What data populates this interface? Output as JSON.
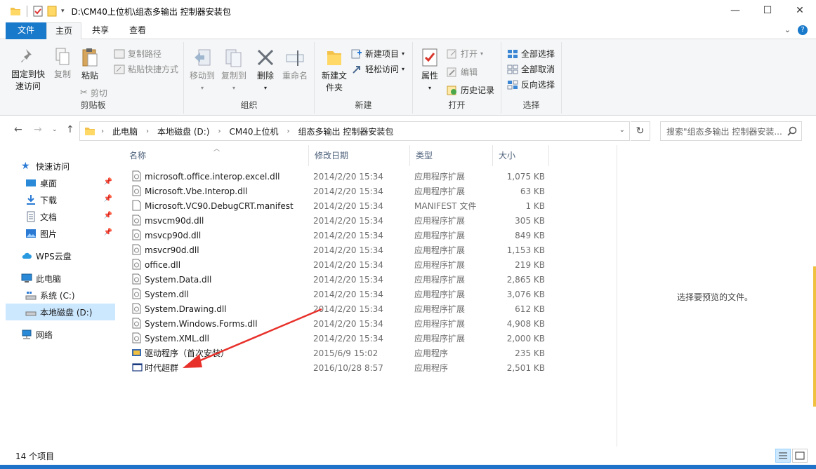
{
  "window": {
    "title": "D:\\CM40上位机\\组态多输出 控制器安装包",
    "controls": {
      "minimize": "—",
      "maximize": "☐",
      "close": "✕"
    }
  },
  "tabs": {
    "file": "文件",
    "home": "主页",
    "share": "共享",
    "view": "查看"
  },
  "ribbon": {
    "clipboard": {
      "label": "剪贴板",
      "pin_quick_access": "固定到快速访问",
      "copy": "复制",
      "paste": "粘贴",
      "copy_path": "复制路径",
      "paste_shortcut": "粘贴快捷方式",
      "cut": "剪切"
    },
    "organize": {
      "label": "组织",
      "move_to": "移动到",
      "copy_to": "复制到",
      "delete": "删除",
      "rename": "重命名"
    },
    "new": {
      "label": "新建",
      "new_folder": "新建文件夹",
      "new_item": "新建项目",
      "easy_access": "轻松访问"
    },
    "open": {
      "label": "打开",
      "properties": "属性",
      "open": "打开",
      "edit": "编辑",
      "history": "历史记录"
    },
    "select": {
      "label": "选择",
      "select_all": "全部选择",
      "select_none": "全部取消",
      "invert": "反向选择"
    }
  },
  "address": {
    "crumbs": [
      "此电脑",
      "本地磁盘 (D:)",
      "CM40上位机",
      "组态多输出 控制器安装包"
    ]
  },
  "search": {
    "placeholder": "搜索\"组态多输出 控制器安装..."
  },
  "nav": {
    "quick_access": "快速访问",
    "desktop": "桌面",
    "downloads": "下载",
    "documents": "文档",
    "pictures": "图片",
    "wps": "WPS云盘",
    "this_pc": "此电脑",
    "system_c": "系统 (C:)",
    "local_d": "本地磁盘 (D:)",
    "network": "网络"
  },
  "columns": {
    "name": "名称",
    "date": "修改日期",
    "type": "类型",
    "size": "大小"
  },
  "files": [
    {
      "name": "microsoft.office.interop.excel.dll",
      "date": "2014/2/20 15:34",
      "type": "应用程序扩展",
      "size": "1,075 KB",
      "icon": "dll-icon"
    },
    {
      "name": "Microsoft.Vbe.Interop.dll",
      "date": "2014/2/20 15:34",
      "type": "应用程序扩展",
      "size": "63 KB",
      "icon": "dll-icon"
    },
    {
      "name": "Microsoft.VC90.DebugCRT.manifest",
      "date": "2014/2/20 15:34",
      "type": "MANIFEST 文件",
      "size": "1 KB",
      "icon": "file-icon"
    },
    {
      "name": "msvcm90d.dll",
      "date": "2014/2/20 15:34",
      "type": "应用程序扩展",
      "size": "305 KB",
      "icon": "dll-icon"
    },
    {
      "name": "msvcp90d.dll",
      "date": "2014/2/20 15:34",
      "type": "应用程序扩展",
      "size": "849 KB",
      "icon": "dll-icon"
    },
    {
      "name": "msvcr90d.dll",
      "date": "2014/2/20 15:34",
      "type": "应用程序扩展",
      "size": "1,153 KB",
      "icon": "dll-icon"
    },
    {
      "name": "office.dll",
      "date": "2014/2/20 15:34",
      "type": "应用程序扩展",
      "size": "219 KB",
      "icon": "dll-icon"
    },
    {
      "name": "System.Data.dll",
      "date": "2014/2/20 15:34",
      "type": "应用程序扩展",
      "size": "2,865 KB",
      "icon": "dll-icon"
    },
    {
      "name": "System.dll",
      "date": "2014/2/20 15:34",
      "type": "应用程序扩展",
      "size": "3,076 KB",
      "icon": "dll-icon"
    },
    {
      "name": "System.Drawing.dll",
      "date": "2014/2/20 15:34",
      "type": "应用程序扩展",
      "size": "612 KB",
      "icon": "dll-icon"
    },
    {
      "name": "System.Windows.Forms.dll",
      "date": "2014/2/20 15:34",
      "type": "应用程序扩展",
      "size": "4,908 KB",
      "icon": "dll-icon"
    },
    {
      "name": "System.XML.dll",
      "date": "2014/2/20 15:34",
      "type": "应用程序扩展",
      "size": "2,000 KB",
      "icon": "dll-icon"
    },
    {
      "name": "驱动程序（首次安装）",
      "date": "2015/6/9 15:02",
      "type": "应用程序",
      "size": "235 KB",
      "icon": "installer-icon"
    },
    {
      "name": "时代超群",
      "date": "2016/10/28 8:57",
      "type": "应用程序",
      "size": "2,501 KB",
      "icon": "app-window-icon"
    }
  ],
  "preview": {
    "text": "选择要预览的文件。"
  },
  "status": {
    "count": "14 个项目"
  },
  "colors": {
    "accent": "#1979ca",
    "selection": "#cce8ff",
    "arrow": "#e8302a"
  }
}
